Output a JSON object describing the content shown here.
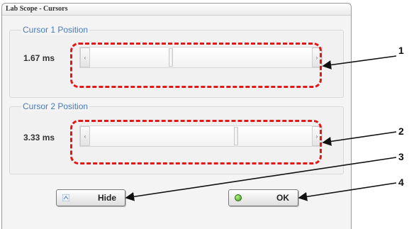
{
  "window": {
    "title": "Lab Scope - Cursors"
  },
  "cursor1": {
    "title": "Cursor 1 Position",
    "value": "1.67 ms",
    "position_fraction": 0.36
  },
  "cursor2": {
    "title": "Cursor 2 Position",
    "value": "3.33 ms",
    "position_fraction": 0.66
  },
  "scroll_arrows": {
    "left": "‹",
    "right": "›"
  },
  "buttons": {
    "hide_label": "Hide",
    "ok_label": "OK"
  },
  "callouts": [
    "1",
    "2",
    "3",
    "4"
  ],
  "colors": {
    "highlight": "#e01818",
    "group_title": "#4a7ab5",
    "ok_led": "#3c9a1a"
  }
}
